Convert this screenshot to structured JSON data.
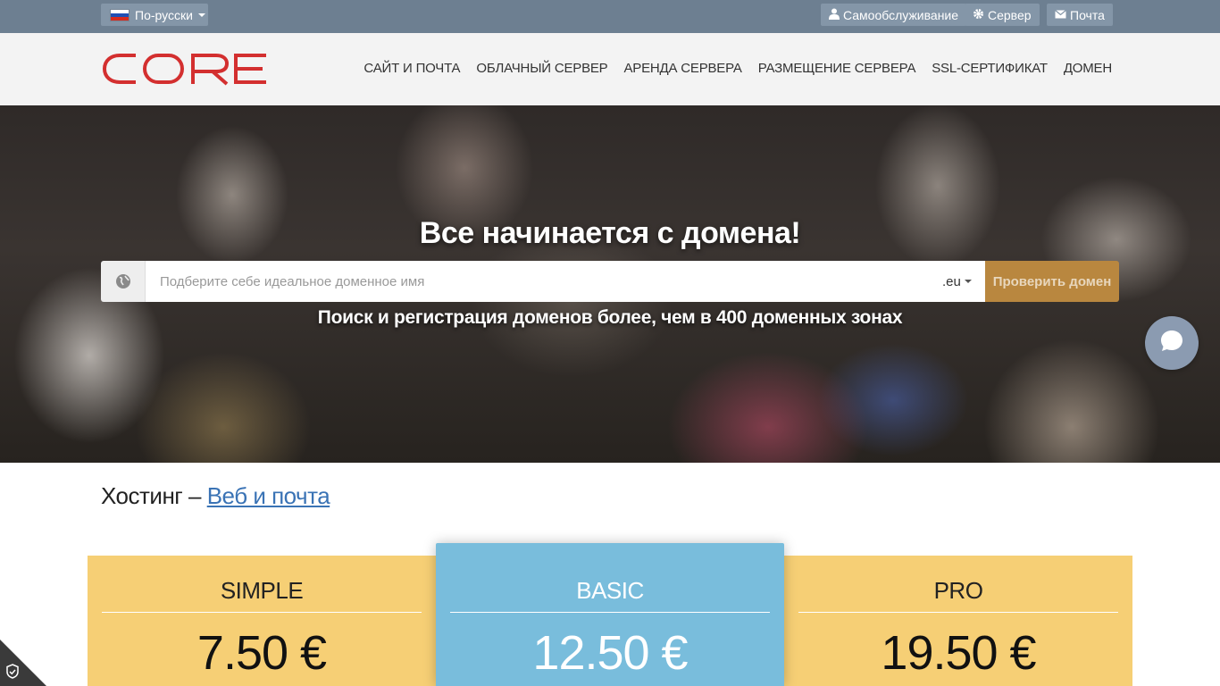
{
  "topbar": {
    "language_label": "По-русски",
    "links": [
      {
        "label": "Самообслуживание",
        "icon": "user-icon"
      },
      {
        "label": "Сервер",
        "icon": "gear-icon"
      },
      {
        "label": "Почта",
        "icon": "mail-icon"
      }
    ]
  },
  "header": {
    "logo_text": "CORE",
    "nav": [
      "САЙТ И ПОЧТА",
      "ОБЛАЧНЫЙ СЕРВЕР",
      "АРЕНДА СЕРВЕРА",
      "РАЗМЕЩЕНИЕ СЕРВЕРА",
      "SSL-СЕРТИФИКАТ",
      "ДОМЕН"
    ]
  },
  "hero": {
    "title": "Все начинается с домена!",
    "search_placeholder": "Подберите себе идеальное доменное имя",
    "tld": ".eu",
    "check_button": "Проверить домен",
    "subtitle": "Поиск и регистрация доменов более, чем в 400 доменных зонах"
  },
  "hosting": {
    "title_prefix": "Хостинг – ",
    "title_link": "Веб и почта",
    "plans": [
      {
        "name": "SIMPLE",
        "price": "7.50 €"
      },
      {
        "name": "BASIC",
        "price": "12.50 €"
      },
      {
        "name": "PRO",
        "price": "19.50 €"
      }
    ]
  },
  "colors": {
    "topbar": "#6d7f91",
    "logo_red": "#d32f2f",
    "check_button": "#b9873f",
    "plan_yellow": "#f6cf75",
    "plan_blue": "#79bddc",
    "link_blue": "#3a73b5"
  }
}
